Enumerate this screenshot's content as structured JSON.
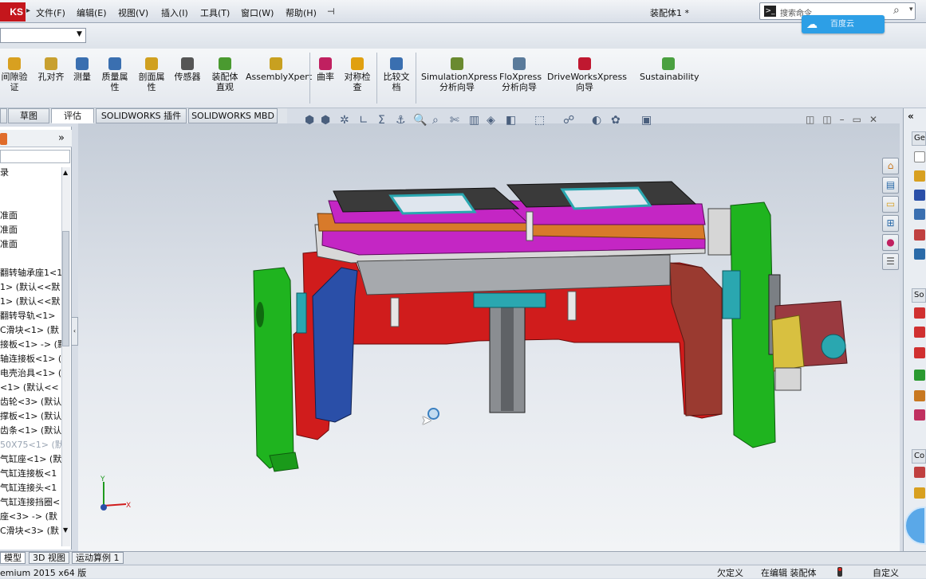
{
  "app": {
    "logo_text": "KS",
    "document_title": "装配体1 *",
    "menus": [
      "文件(F)",
      "编辑(E)",
      "视图(V)",
      "插入(I)",
      "工具(T)",
      "窗口(W)",
      "帮助(H)"
    ],
    "search_placeholder": "搜索命令",
    "cloud_badge_text": "百度云"
  },
  "command_manager": {
    "tools": [
      {
        "label": "间隙验\n证",
        "icon": "clearance-verification-icon",
        "color": "#d8a020"
      },
      {
        "label": "孔对齐",
        "icon": "hole-alignment-icon",
        "color": "#c8a030"
      },
      {
        "label": "测量",
        "icon": "measure-icon",
        "color": "#3a6fb0"
      },
      {
        "label": "质量属\n性",
        "icon": "mass-properties-icon",
        "color": "#3a6fb0"
      },
      {
        "label": "剖面属\n性",
        "icon": "section-properties-icon",
        "color": "#d0a020"
      },
      {
        "label": "传感器",
        "icon": "sensor-icon",
        "color": "#555555"
      },
      {
        "label": "装配体\n直观",
        "icon": "assembly-visualization-icon",
        "color": "#4a9a30"
      },
      {
        "label": "AssemblyXpert",
        "icon": "assemblyxpert-icon",
        "color": "#c8a020"
      },
      {
        "label": "曲率",
        "icon": "curvature-icon",
        "color": "#c02060"
      },
      {
        "label": "对称检\n查",
        "icon": "symmetry-check-icon",
        "color": "#e0a010"
      },
      {
        "label": "比较文\n档",
        "icon": "compare-documents-icon",
        "color": "#3a6fb0"
      },
      {
        "label": "SimulationXpress\n分析向导",
        "icon": "simulationxpress-icon",
        "color": "#6a8a30"
      },
      {
        "label": "FloXpress\n分析向导",
        "icon": "floxpress-icon",
        "color": "#5a7a9a"
      },
      {
        "label": "DriveWorksXpress\n向导",
        "icon": "driveworksxpress-icon",
        "color": "#c01830"
      },
      {
        "label": "Sustainability",
        "icon": "sustainability-icon",
        "color": "#4aa040"
      }
    ],
    "tabs": [
      "草图",
      "评估",
      "SOLIDWORKS 插件",
      "SOLIDWORKS MBD"
    ],
    "active_tab": "评估"
  },
  "feature_tree": {
    "items": [
      "录",
      "",
      "",
      "准面",
      "准面",
      "准面",
      "",
      "翻转轴承座1<1",
      "1> (默认<<默",
      "1> (默认<<默",
      "翻转导轨<1>",
      "C滑块<1> (默",
      "接板<1> -> (默",
      "轴连接板<1> (",
      "电壳治具<1> (",
      "<1> (默认<<",
      "齿轮<3> (默认",
      "撑板<1> (默认",
      "齿条<1> (默认",
      "50X75<1> (默",
      "气缸座<1> (默",
      "气缸连接板<1",
      "气缸连接头<1",
      "气缸连接挡圈<",
      "座<3> -> (默",
      "C滑块<3> (默"
    ]
  },
  "bottom_tabs": [
    "模型",
    "3D 视图",
    "运动算例 1"
  ],
  "status": {
    "product": "emium 2015 x64 版",
    "underdefined": "欠定义",
    "editing": "在编辑 装配体",
    "custom": "自定义"
  },
  "triad": {
    "x": "X",
    "y": "Y"
  },
  "right_pane": {
    "headers": [
      "Ge",
      "So",
      "Co"
    ]
  },
  "colors": {
    "green": "#1fb41f",
    "red": "#d01c1c",
    "magenta": "#c426c4",
    "orange": "#d87a2a",
    "blue": "#2a4fa8",
    "gray": "#9aa0a6",
    "teal": "#2aa7b0"
  }
}
